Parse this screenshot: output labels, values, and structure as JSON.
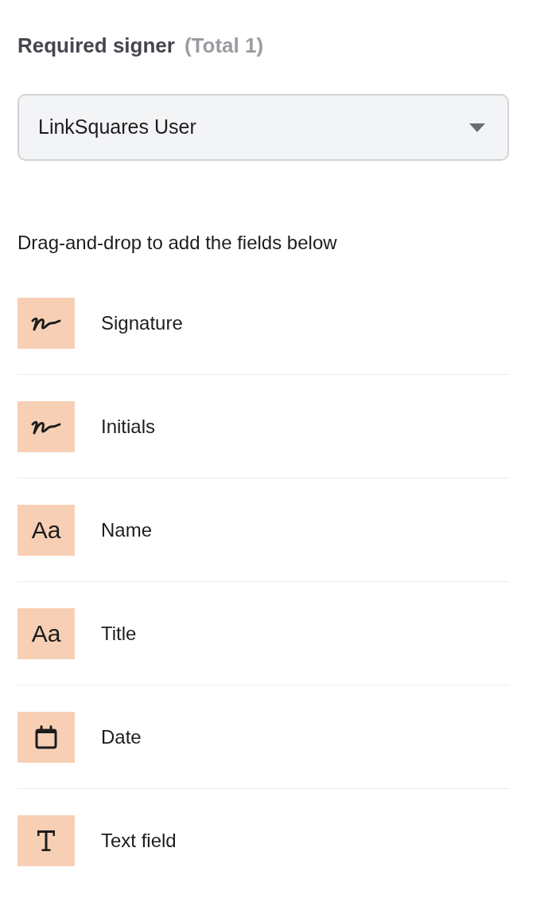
{
  "heading": {
    "label": "Required signer",
    "count": "(Total 1)"
  },
  "signer_select": {
    "value": "LinkSquares User"
  },
  "instruction": "Drag-and-drop to add the fields below",
  "fields": [
    {
      "kind": "signature",
      "label": "Signature"
    },
    {
      "kind": "signature",
      "label": "Initials"
    },
    {
      "kind": "glyph",
      "glyph": "Aa",
      "label": "Name"
    },
    {
      "kind": "glyph",
      "glyph": "Aa",
      "label": "Title"
    },
    {
      "kind": "calendar",
      "label": "Date"
    },
    {
      "kind": "text",
      "label": "Text field"
    }
  ]
}
